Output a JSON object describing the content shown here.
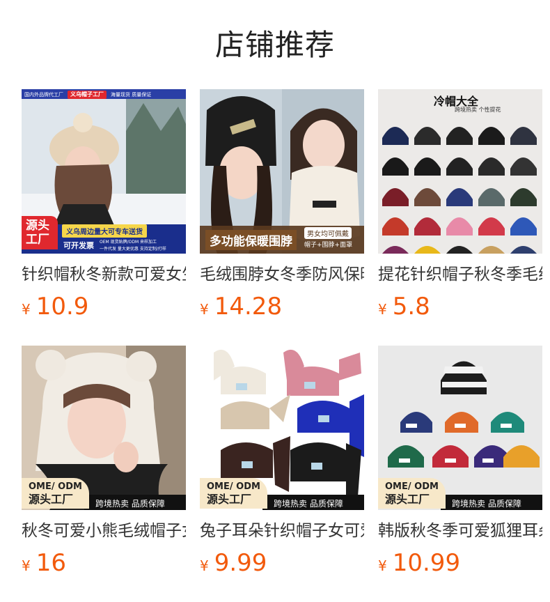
{
  "page": {
    "title": "店铺推荐"
  },
  "currency_symbol": "¥",
  "products": [
    {
      "name": "针织帽秋冬新款可爱女生毛线帽",
      "price": "10.9",
      "overlay": {
        "top_left": "国内外品牌代工厂",
        "top_brand": "义乌帽子工厂",
        "top_right": "海量现货 质量保证",
        "corner": "源头工厂",
        "strip_main": "义乌周边量大可专车送货",
        "strip_left": "可开发票",
        "strip_detail_1": "OEM 现货贴牌/ODM 来样加工",
        "strip_detail_2": "一件代发  量大更优惠  支持定制/打样"
      }
    },
    {
      "name": "毛绒围脖女冬季防风保暖帽子",
      "price": "14.28",
      "overlay": {
        "banner": "多功能保暖围脖",
        "side_top": "男女均可佩戴",
        "side_bottom": "帽子+围脖+面罩"
      }
    },
    {
      "name": "提花针织帽子秋冬季毛线帽",
      "price": "5.8",
      "overlay": {
        "heading": "冷帽大全",
        "subheading": "跨境热卖 个性提花"
      }
    },
    {
      "name": "秋冬可爱小熊毛绒帽子女",
      "price": "16",
      "overlay": {
        "pill_top": "OME/ ODM",
        "pill_bottom": "源头工厂",
        "strip": "跨境热卖 品质保障"
      }
    },
    {
      "name": "兔子耳朵针织帽子女可爱",
      "price": "9.99",
      "overlay": {
        "pill_top": "OME/ ODM",
        "pill_bottom": "源头工厂",
        "strip": "跨境热卖 品质保障"
      }
    },
    {
      "name": "韩版秋冬季可爱狐狸耳朵帽",
      "price": "10.99",
      "overlay": {
        "pill_top": "OME/ ODM",
        "pill_bottom": "源头工厂",
        "strip": "跨境热卖 品质保障"
      }
    }
  ]
}
